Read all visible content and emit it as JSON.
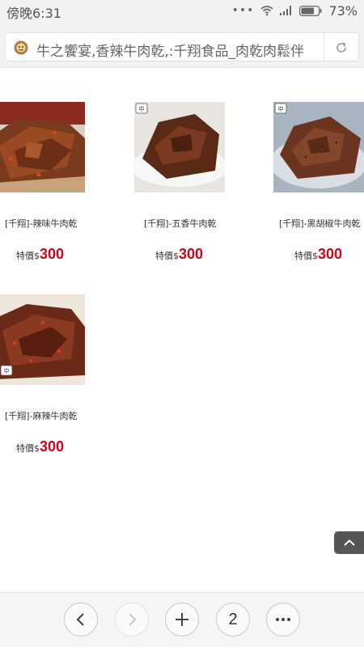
{
  "status_bar": {
    "time": "傍晚6:31",
    "battery": "73%"
  },
  "address_bar": {
    "url_text": "牛之饗宴,香辣牛肉乾,:千翔食品_肉乾肉鬆伴"
  },
  "products": [
    {
      "name": "[千翔]-辣味牛肉乾",
      "price_label": "特價",
      "currency": "$",
      "price": "300"
    },
    {
      "name": "[千翔]-五香牛肉乾",
      "price_label": "特價",
      "currency": "$",
      "price": "300"
    },
    {
      "name": "[千翔]-黑胡椒牛肉乾",
      "price_label": "特價",
      "currency": "$",
      "price": "300"
    },
    {
      "name": "[千翔]-麻辣牛肉乾",
      "price_label": "特價",
      "currency": "$",
      "price": "300"
    }
  ],
  "toolbar": {
    "tab_count": "2"
  },
  "icons": {
    "status": [
      "more-dots-icon",
      "wifi-icon",
      "signal-icon",
      "battery-icon"
    ],
    "address": [
      "site-favicon-icon",
      "reload-icon"
    ],
    "toolbar": [
      "back-icon",
      "forward-icon",
      "new-tab-icon",
      "tabs-icon",
      "menu-icon"
    ],
    "floating": [
      "back-to-top-icon"
    ]
  },
  "colors": {
    "price": "#d0021b",
    "chrome_bg": "#f2f2f2"
  }
}
